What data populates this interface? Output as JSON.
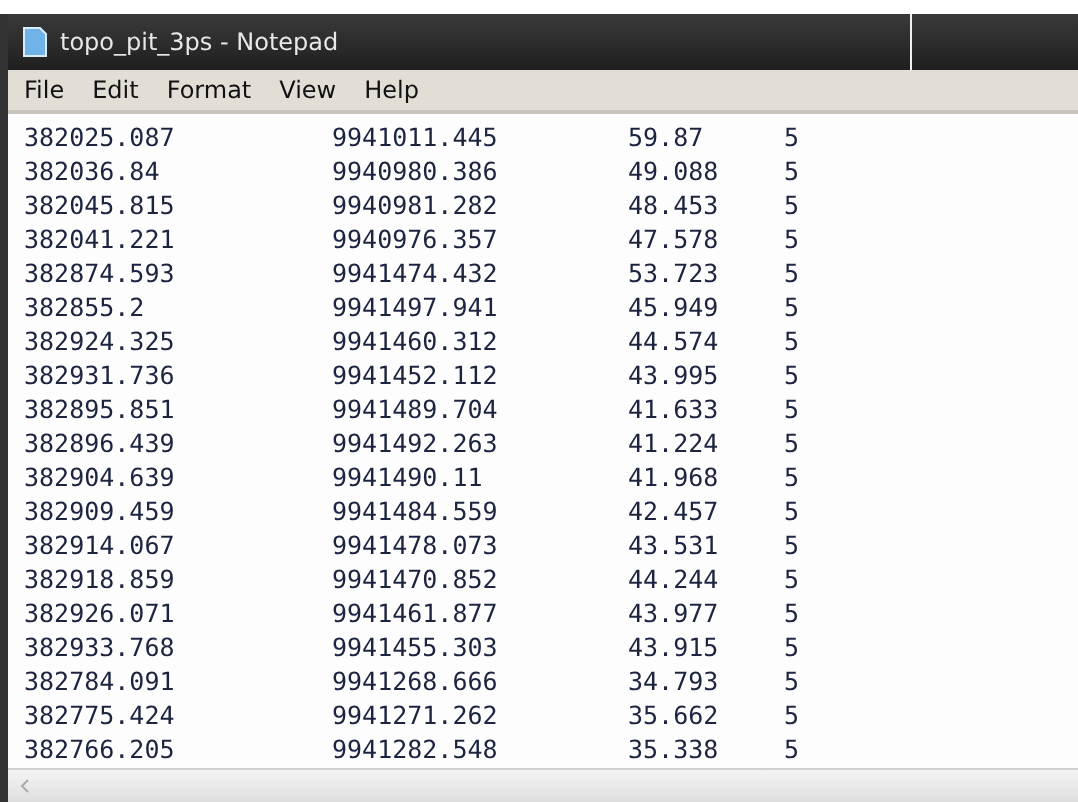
{
  "window": {
    "title": "topo_pit_3ps - Notepad"
  },
  "menu": [
    "File",
    "Edit",
    "Format",
    "View",
    "Help"
  ],
  "rows": [
    [
      "382025.087",
      "9941011.445",
      "59.87",
      "5"
    ],
    [
      "382036.84",
      "9940980.386",
      "49.088",
      "5"
    ],
    [
      "382045.815",
      "9940981.282",
      "48.453",
      "5"
    ],
    [
      "382041.221",
      "9940976.357",
      "47.578",
      "5"
    ],
    [
      "382874.593",
      "9941474.432",
      "53.723",
      "5"
    ],
    [
      "382855.2",
      "9941497.941",
      "45.949",
      "5"
    ],
    [
      "382924.325",
      "9941460.312",
      "44.574",
      "5"
    ],
    [
      "382931.736",
      "9941452.112",
      "43.995",
      "5"
    ],
    [
      "382895.851",
      "9941489.704",
      "41.633",
      "5"
    ],
    [
      "382896.439",
      "9941492.263",
      "41.224",
      "5"
    ],
    [
      "382904.639",
      "9941490.11",
      "41.968",
      "5"
    ],
    [
      "382909.459",
      "9941484.559",
      "42.457",
      "5"
    ],
    [
      "382914.067",
      "9941478.073",
      "43.531",
      "5"
    ],
    [
      "382918.859",
      "9941470.852",
      "44.244",
      "5"
    ],
    [
      "382926.071",
      "9941461.877",
      "43.977",
      "5"
    ],
    [
      "382933.768",
      "9941455.303",
      "43.915",
      "5"
    ],
    [
      "382784.091",
      "9941268.666",
      "34.793",
      "5"
    ],
    [
      "382775.424",
      "9941271.262",
      "35.662",
      "5"
    ],
    [
      "382766.205",
      "9941282.548",
      "35.338",
      "5"
    ]
  ]
}
